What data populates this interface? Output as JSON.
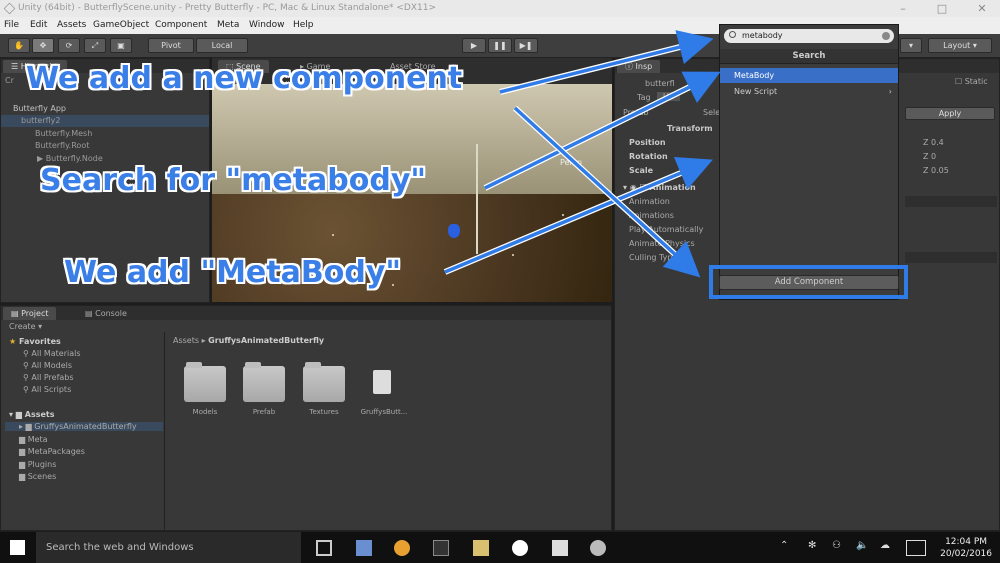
{
  "window": {
    "title": "Unity (64bit) - ButterflyScene.unity - Pretty Butterfly - PC, Mac & Linux Standalone* <DX11>"
  },
  "menu": [
    "File",
    "Edit",
    "Assets",
    "GameObject",
    "Component",
    "Meta",
    "Window",
    "Help"
  ],
  "toolbar": {
    "pivot": "Pivot",
    "local": "Local",
    "layout": "Layout"
  },
  "hierarchy": {
    "create": "Cr",
    "rows": [
      "Butterfly App",
      "butterfly2",
      "Butterfly.Mesh",
      "Butterfly.Root",
      "▶ Butterfly.Node"
    ]
  },
  "scene_tabs": [
    "Scene",
    "Game",
    "Asset Store"
  ],
  "scene": {
    "persp": "Persp"
  },
  "project": {
    "tabs": [
      "Project",
      "Console"
    ],
    "create": "Create ▾",
    "favorites_label": "Favorites",
    "favorites": [
      "All Materials",
      "All Models",
      "All Prefabs",
      "All Scripts"
    ],
    "assets_label": "Assets",
    "assets": [
      "GruffysAnimatedButterfly",
      "Meta",
      "MetaPackages",
      "Plugins",
      "Scenes"
    ],
    "breadcrumb": [
      "Assets",
      "GruffysAnimatedButterfly"
    ],
    "files": [
      "Models",
      "Prefab",
      "Textures",
      "GruffysButt..."
    ]
  },
  "inspector": {
    "tab": "Insp",
    "name": "butterfl",
    "tag": "Tag",
    "tag_value": "Un",
    "prefab": "Prefab",
    "prefab_select": "Sele",
    "apply": "Apply",
    "static": "Static",
    "transform": "Transform",
    "position": "Position",
    "rotation": "Rotation",
    "scale": "Scale",
    "z_values": [
      "Z 0.4",
      "Z 0",
      "Z 0.05"
    ],
    "animation": "Animation",
    "animation_rows": [
      "Animation",
      "Animations",
      "Play Automatically",
      "Animate Physics",
      "Culling Type"
    ]
  },
  "component_popup": {
    "search_value": "metabody",
    "header": "Search",
    "items": [
      "MetaBody",
      "New Script"
    ],
    "add_component": "Add Component"
  },
  "annotations": {
    "a1": "We add a new component",
    "a2": "Search for \"metabody\"",
    "a3": "We add \"MetaBody\"",
    "color": "#3a7fe8"
  },
  "taskbar": {
    "search": "Search the web and Windows",
    "time": "12:04 PM",
    "date": "20/02/2016"
  }
}
